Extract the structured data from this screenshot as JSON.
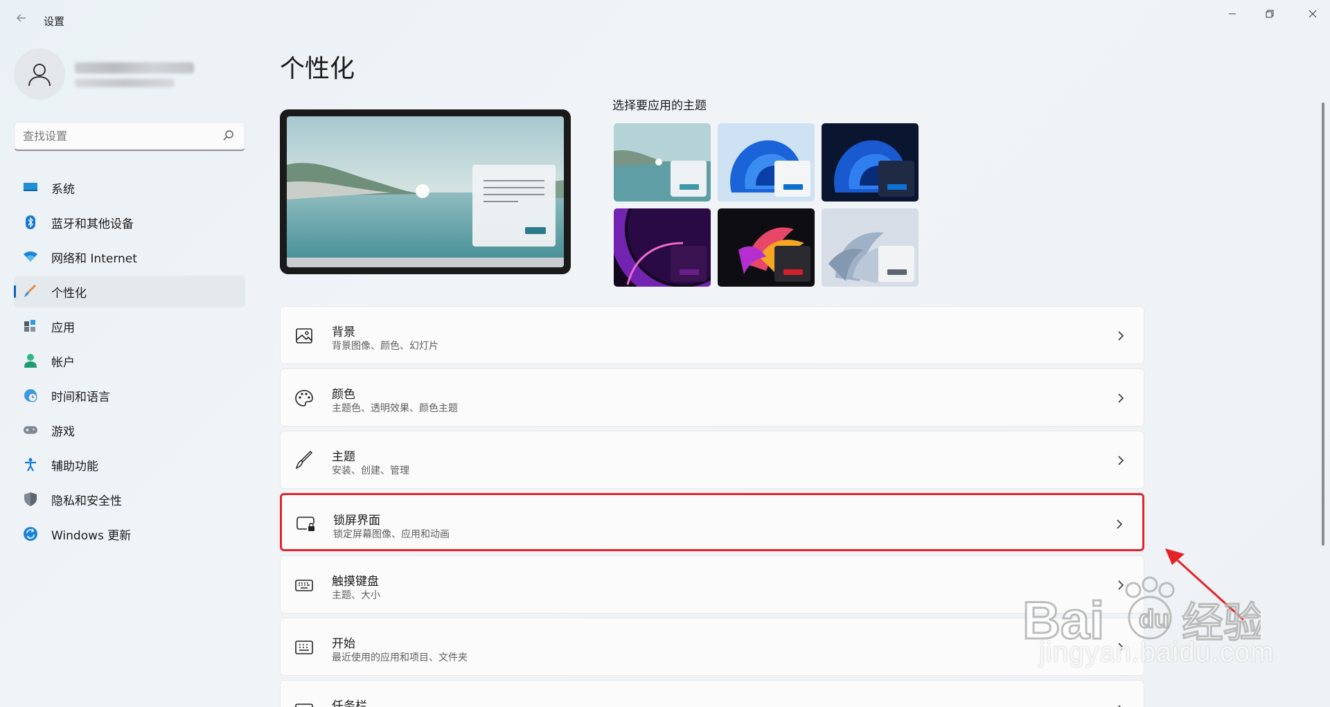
{
  "window": {
    "title": "设置"
  },
  "search": {
    "placeholder": "查找设置"
  },
  "sidebar": {
    "items": [
      {
        "label": "系统",
        "icon": "monitor-icon"
      },
      {
        "label": "蓝牙和其他设备",
        "icon": "bluetooth-icon"
      },
      {
        "label": "网络和 Internet",
        "icon": "wifi-icon"
      },
      {
        "label": "个性化",
        "icon": "brush-icon",
        "active": true
      },
      {
        "label": "应用",
        "icon": "apps-icon"
      },
      {
        "label": "帐户",
        "icon": "person-icon"
      },
      {
        "label": "时间和语言",
        "icon": "globe-clock-icon"
      },
      {
        "label": "游戏",
        "icon": "gamepad-icon"
      },
      {
        "label": "辅助功能",
        "icon": "accessibility-icon"
      },
      {
        "label": "隐私和安全性",
        "icon": "shield-icon"
      },
      {
        "label": "Windows 更新",
        "icon": "update-icon"
      }
    ]
  },
  "main": {
    "title": "个性化",
    "themes_label": "选择要应用的主题",
    "themes": [
      {
        "name": "lake",
        "accent": "#3f97a8"
      },
      {
        "name": "bloom-light",
        "accent": "#0a6fd0"
      },
      {
        "name": "bloom-dark",
        "accent": "#0b74d8"
      },
      {
        "name": "glow",
        "accent": "#6a1e8c"
      },
      {
        "name": "captured-motion",
        "accent": "#d21f2a"
      },
      {
        "name": "flow",
        "accent": "#5c6670"
      }
    ],
    "cards": [
      {
        "title": "背景",
        "subtitle": "背景图像、颜色、幻灯片",
        "icon": "image-icon"
      },
      {
        "title": "颜色",
        "subtitle": "主题色、透明效果、颜色主题",
        "icon": "palette-icon"
      },
      {
        "title": "主题",
        "subtitle": "安装、创建、管理",
        "icon": "brush-icon"
      },
      {
        "title": "锁屏界面",
        "subtitle": "锁定屏幕图像、应用和动画",
        "icon": "lock-screen-icon",
        "highlighted": true
      },
      {
        "title": "触摸键盘",
        "subtitle": "主题、大小",
        "icon": "keyboard-icon"
      },
      {
        "title": "开始",
        "subtitle": "最近使用的应用和项目、文件夹",
        "icon": "start-icon"
      },
      {
        "title": "任务栏",
        "subtitle": "",
        "icon": "taskbar-icon"
      }
    ]
  },
  "watermark": {
    "text": "jingyan.baidu.com"
  },
  "colors": {
    "accent": "#0a63b5",
    "highlight": "#e3242b"
  }
}
